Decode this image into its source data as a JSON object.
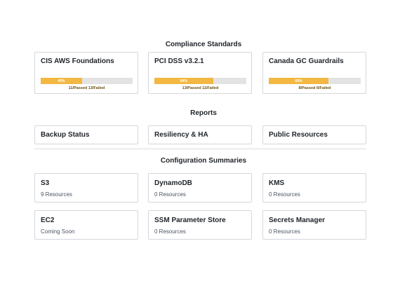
{
  "compliance": {
    "title": "Compliance Standards",
    "cards": [
      {
        "title": "CIS AWS Foundations",
        "percent": 45,
        "percent_label": "45%",
        "caption": "11/Passed 13/Failed",
        "bar_color": "#f2b843"
      },
      {
        "title": "PCI DSS v3.2.1",
        "percent": 64,
        "percent_label": "64%",
        "caption": "13/Passed 11/Failed",
        "bar_color": "#f2b843"
      },
      {
        "title": "Canada GC Guardrails",
        "percent": 65,
        "percent_label": "65%",
        "caption": "8/Passed 6/Failed",
        "bar_color": "#f2b843"
      }
    ]
  },
  "reports": {
    "title": "Reports",
    "items": [
      {
        "label": "Backup Status"
      },
      {
        "label": "Resiliency & HA"
      },
      {
        "label": "Public Resources"
      }
    ]
  },
  "config": {
    "title": "Configuration Summaries",
    "items": [
      {
        "title": "S3",
        "subtitle": "9 Resources"
      },
      {
        "title": "DynamoDB",
        "subtitle": "0 Resources"
      },
      {
        "title": "KMS",
        "subtitle": "0 Resources"
      },
      {
        "title": "EC2",
        "subtitle": "Coming Soon"
      },
      {
        "title": "SSM Parameter Store",
        "subtitle": "0 Resources"
      },
      {
        "title": "Secrets Manager",
        "subtitle": "0 Resources"
      }
    ]
  }
}
